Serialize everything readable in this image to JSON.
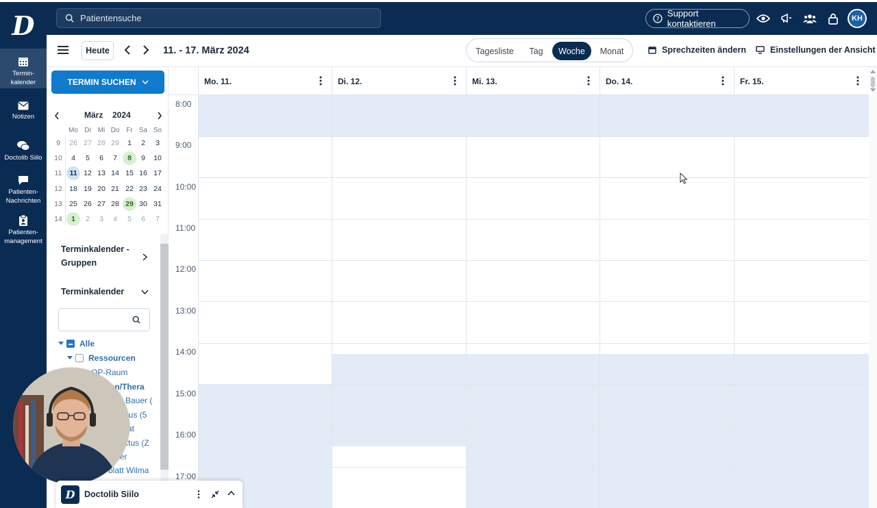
{
  "app": {
    "logo_letter": "D",
    "colors": {
      "navy": "#0b2c52",
      "accent": "#107acc",
      "shade": "#e3ecf6"
    }
  },
  "topbar": {
    "search_placeholder": "Patientensuche",
    "support_label": "Support kontaktieren",
    "icons": [
      "eye-icon",
      "megaphone-icon",
      "team-icon",
      "lock-icon"
    ],
    "avatar_initials": "KH"
  },
  "sidenav": {
    "items": [
      {
        "label": "Termin-\nkalender",
        "icon": "calendar-icon",
        "active": true
      },
      {
        "label": "Notizen",
        "icon": "mail-icon"
      },
      {
        "label": "Doctolib Siilo",
        "icon": "chat-icon"
      },
      {
        "label": "Patienten-\nNachrichten",
        "icon": "message-icon"
      },
      {
        "label": "Patienten-\nmanagement",
        "icon": "clipboard-icon"
      }
    ]
  },
  "toolbar": {
    "today_label": "Heute",
    "date_range": "11. - 17. März 2024",
    "views": [
      "Tagesliste",
      "Tag",
      "Woche",
      "Monat"
    ],
    "active_view": "Woche",
    "office_hours_label": "Sprechzeiten ändern",
    "view_settings_label": "Einstellungen der Ansicht"
  },
  "left": {
    "search_button": "TERMIN SUCHEN",
    "minical": {
      "month": "März",
      "year": "2024",
      "dow": [
        "Mo",
        "Di",
        "Mi",
        "Do",
        "Fr",
        "Sa",
        "So"
      ],
      "weeks": [
        {
          "wk": "9",
          "days": [
            "26",
            "27",
            "28",
            "29",
            "1",
            "2",
            "3"
          ]
        },
        {
          "wk": "10",
          "days": [
            "4",
            "5",
            "6",
            "7",
            "8",
            "9",
            "10"
          ]
        },
        {
          "wk": "11",
          "days": [
            "11",
            "12",
            "13",
            "14",
            "15",
            "16",
            "17"
          ]
        },
        {
          "wk": "12",
          "days": [
            "18",
            "19",
            "20",
            "21",
            "22",
            "23",
            "24"
          ]
        },
        {
          "wk": "13",
          "days": [
            "25",
            "26",
            "27",
            "28",
            "29",
            "30",
            "31"
          ]
        },
        {
          "wk": "14",
          "days": [
            "1",
            "2",
            "3",
            "4",
            "5",
            "6",
            "7"
          ]
        }
      ]
    },
    "groups_title_1": "Terminkalender -",
    "groups_title_2": "Gruppen",
    "calendars_title": "Terminkalender",
    "tree": {
      "all": "Alle",
      "resources": "Ressourcen",
      "items": [
        "OP-Raum",
        "men/Thera",
        "Bauer (",
        "rius (5",
        "at",
        "ktus (Z",
        "ler",
        "blatt Wilma"
      ]
    }
  },
  "calendar": {
    "columns": [
      "Mo. 11.",
      "Di. 12.",
      "Mi. 13.",
      "Do. 14.",
      "Fr. 15."
    ],
    "times": [
      "8:00",
      "9:00",
      "10:00",
      "11:00",
      "12:00",
      "13:00",
      "14:00",
      "15:00",
      "16:00",
      "17:00"
    ]
  },
  "siilo_widget": {
    "title": "Doctolib Siilo",
    "logo_letter": "D"
  }
}
